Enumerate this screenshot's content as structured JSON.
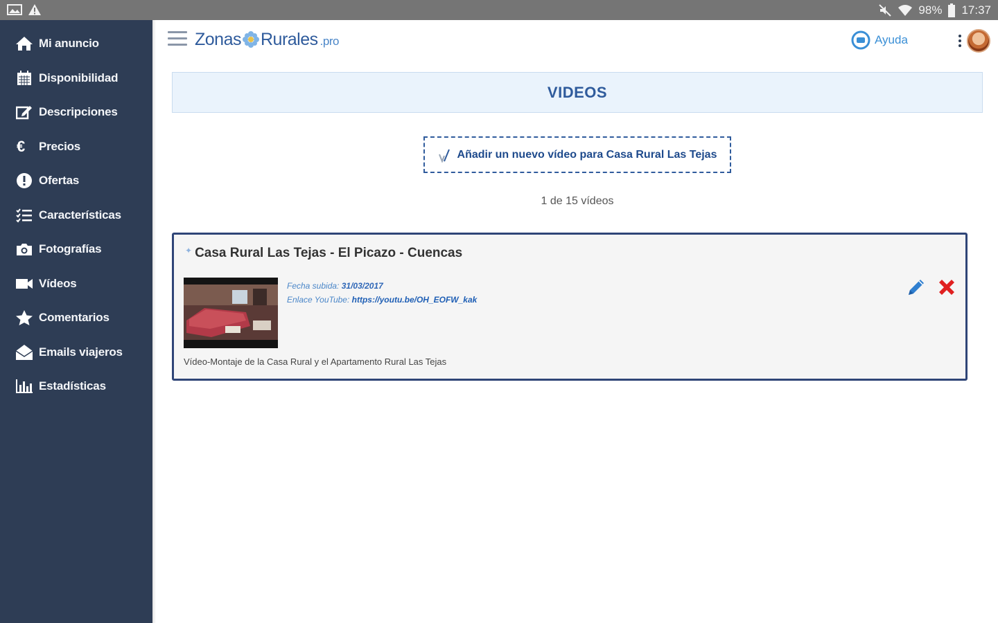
{
  "status_bar": {
    "battery": "98%",
    "time": "17:37",
    "icons_left": [
      "image-notification-icon",
      "warning-icon"
    ],
    "icons_right": [
      "mute-icon",
      "wifi-icon",
      "battery-icon"
    ]
  },
  "sidebar": {
    "background": "#2e3d55",
    "items": [
      {
        "label": "Mi anuncio",
        "icon": "home-icon"
      },
      {
        "label": "Disponibilidad",
        "icon": "calendar-icon"
      },
      {
        "label": "Descripciones",
        "icon": "edit-icon"
      },
      {
        "label": "Precios",
        "icon": "euro-icon"
      },
      {
        "label": "Ofertas",
        "icon": "alert-circle-icon"
      },
      {
        "label": "Características",
        "icon": "list-icon"
      },
      {
        "label": "Fotografías",
        "icon": "camera-icon"
      },
      {
        "label": "Vídeos",
        "icon": "video-camera-icon"
      },
      {
        "label": "Comentarios",
        "icon": "star-icon"
      },
      {
        "label": "Emails viajeros",
        "icon": "envelope-open-icon"
      },
      {
        "label": "Estadísticas",
        "icon": "bar-chart-icon"
      }
    ]
  },
  "header": {
    "logo_part1": "Zonas",
    "logo_part2": "Rurales",
    "logo_suffix": ".pro",
    "help_label": "Ayuda"
  },
  "main": {
    "section_title": "VIDEOS",
    "add_video_label": "Añadir un nuevo vídeo para Casa Rural Las Tejas",
    "count_text": "1 de 15 vídeos",
    "video": {
      "title": "Casa Rural Las Tejas - El Picazo - Cuencas",
      "date_label": "Fecha subida:",
      "date_value": "31/03/2017",
      "youtube_label": "Enlace YouTube:",
      "youtube_value": "https://youtu.be/OH_EOFW_kak",
      "description": "Vídeo-Montaje de la Casa Rural y el Apartamento Rural Las Tejas"
    }
  },
  "colors": {
    "accent": "#2f5b9c",
    "header_bg": "#eaf3fc",
    "delete": "#e02020",
    "edit": "#2f7fd0"
  }
}
